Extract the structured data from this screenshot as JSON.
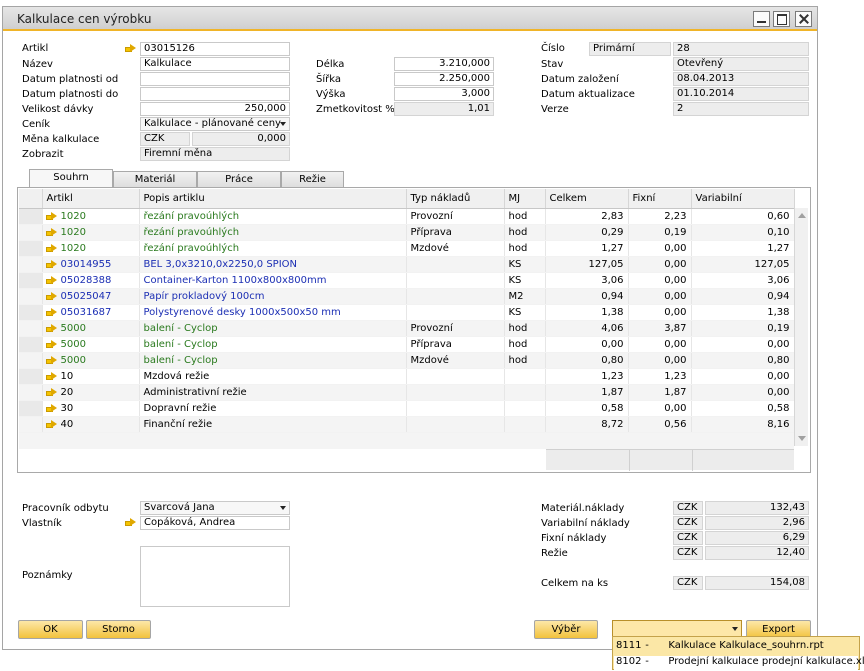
{
  "window": {
    "title": "Kalkulace cen výrobku"
  },
  "header_left": {
    "artikl": {
      "label": "Artikl",
      "value": "03015126"
    },
    "nazev": {
      "label": "Název",
      "value": "Kalkulace"
    },
    "platnost_od": {
      "label": "Datum platnosti od",
      "value": ""
    },
    "platnost_do": {
      "label": "Datum platnosti do",
      "value": ""
    },
    "velikost_davky": {
      "label": "Velikost dávky",
      "value": "250,000"
    },
    "cenik": {
      "label": "Ceník",
      "value": "Kalkulace - plánované ceny"
    },
    "mena": {
      "label": "Měna kalkulace",
      "currency": "CZK",
      "value": "0,000"
    },
    "zobrazit": {
      "label": "Zobrazit",
      "value": "Firemní měna"
    }
  },
  "header_mid": {
    "delka": {
      "label": "Délka",
      "value": "3.210,000"
    },
    "sirka": {
      "label": "Šířka",
      "value": "2.250,000"
    },
    "vyska": {
      "label": "Výška",
      "value": "3,000"
    },
    "zmetkovitost": {
      "label": "Zmetkovitost %",
      "value": "1,01"
    }
  },
  "header_right": {
    "cislo": {
      "label": "Číslo",
      "series": "Primární",
      "value": "28"
    },
    "stav": {
      "label": "Stav",
      "value": "Otevřený"
    },
    "zalozeni": {
      "label": "Datum založení",
      "value": "08.04.2013"
    },
    "aktualizace": {
      "label": "Datum aktualizace",
      "value": "01.10.2014"
    },
    "verze": {
      "label": "Verze",
      "value": "2"
    }
  },
  "tabs": [
    "Souhrn",
    "Materiál",
    "Práce",
    "Režie"
  ],
  "grid": {
    "columns": [
      "Artikl",
      "Popis artiklu",
      "Typ nákladů",
      "MJ",
      "Celkem",
      "Fixní",
      "Variabilní"
    ],
    "rows": [
      {
        "artikl": "1020",
        "popis": "řezání pravoúhlých",
        "typ": "Provozní",
        "mj": "hod",
        "celkem": "2,83",
        "fixni": "2,23",
        "variabilni": "0,60",
        "color": "green",
        "arrow": true
      },
      {
        "artikl": "1020",
        "popis": "řezání pravoúhlých",
        "typ": "Příprava",
        "mj": "hod",
        "celkem": "0,29",
        "fixni": "0,19",
        "variabilni": "0,10",
        "color": "green",
        "arrow": true
      },
      {
        "artikl": "1020",
        "popis": "řezání pravoúhlých",
        "typ": "Mzdové",
        "mj": "hod",
        "celkem": "1,27",
        "fixni": "0,00",
        "variabilni": "1,27",
        "color": "green",
        "arrow": true
      },
      {
        "artikl": "03014955",
        "popis": "BEL 3,0x3210,0x2250,0 SPION",
        "typ": "",
        "mj": "KS",
        "celkem": "127,05",
        "fixni": "0,00",
        "variabilni": "127,05",
        "color": "blue",
        "arrow": true
      },
      {
        "artikl": "05028388",
        "popis": "Container-Karton 1100x800x800mm",
        "typ": "",
        "mj": "KS",
        "celkem": "3,06",
        "fixni": "0,00",
        "variabilni": "3,06",
        "color": "blue",
        "arrow": true
      },
      {
        "artikl": "05025047",
        "popis": "Papír prokladový 100cm",
        "typ": "",
        "mj": "M2",
        "celkem": "0,94",
        "fixni": "0,00",
        "variabilni": "0,94",
        "color": "blue",
        "arrow": true
      },
      {
        "artikl": "05031687",
        "popis": "Polystyrenové desky 1000x500x50 mm",
        "typ": "",
        "mj": "KS",
        "celkem": "1,38",
        "fixni": "0,00",
        "variabilni": "1,38",
        "color": "blue",
        "arrow": true
      },
      {
        "artikl": "5000",
        "popis": "balení - Cyclop",
        "typ": "Provozní",
        "mj": "hod",
        "celkem": "4,06",
        "fixni": "3,87",
        "variabilni": "0,19",
        "color": "green",
        "arrow": true
      },
      {
        "artikl": "5000",
        "popis": "balení - Cyclop",
        "typ": "Příprava",
        "mj": "hod",
        "celkem": "0,00",
        "fixni": "0,00",
        "variabilni": "0,00",
        "color": "green",
        "arrow": true
      },
      {
        "artikl": "5000",
        "popis": "balení - Cyclop",
        "typ": "Mzdové",
        "mj": "hod",
        "celkem": "0,80",
        "fixni": "0,00",
        "variabilni": "0,80",
        "color": "green",
        "arrow": true
      },
      {
        "artikl": "10",
        "popis": "Mzdová režie",
        "typ": "",
        "mj": "",
        "celkem": "1,23",
        "fixni": "1,23",
        "variabilni": "0,00",
        "color": "black",
        "arrow": true
      },
      {
        "artikl": "20",
        "popis": "Administrativní režie",
        "typ": "",
        "mj": "",
        "celkem": "1,87",
        "fixni": "1,87",
        "variabilni": "0,00",
        "color": "black",
        "arrow": true
      },
      {
        "artikl": "30",
        "popis": "Dopravní režie",
        "typ": "",
        "mj": "",
        "celkem": "0,58",
        "fixni": "0,00",
        "variabilni": "0,58",
        "color": "black",
        "arrow": true
      },
      {
        "artikl": "40",
        "popis": "Finanční režie",
        "typ": "",
        "mj": "",
        "celkem": "8,72",
        "fixni": "0,56",
        "variabilni": "8,16",
        "color": "black",
        "arrow": true
      }
    ]
  },
  "footer_left": {
    "pracovnik": {
      "label": "Pracovník odbytu",
      "value": "Švarcová Jana"
    },
    "vlastnik": {
      "label": "Vlastník",
      "value": "Copáková, Andrea"
    },
    "poznamky": {
      "label": "Poznámky",
      "value": ""
    }
  },
  "totals": {
    "material": {
      "label": "Materiál.náklady",
      "currency": "CZK",
      "value": "132,43"
    },
    "variabilni": {
      "label": "Variabilní náklady",
      "currency": "CZK",
      "value": "2,96"
    },
    "fixni": {
      "label": "Fixní náklady",
      "currency": "CZK",
      "value": "6,29"
    },
    "rezie": {
      "label": "Režie",
      "currency": "CZK",
      "value": "12,40"
    },
    "celkem": {
      "label": "Celkem na ks",
      "currency": "CZK",
      "value": "154,08"
    }
  },
  "buttons": {
    "ok": "OK",
    "storno": "Storno",
    "vyber": "Výběr",
    "export": "Export"
  },
  "report_dropdown": {
    "value": "",
    "options": [
      {
        "code": "8111",
        "sep": "-",
        "name": "Kalkulace Kalkulace_souhrn.rpt"
      },
      {
        "code": "8102",
        "sep": "-",
        "name": "Prodejní kalkulace prodejní kalkulace.xltm"
      }
    ]
  },
  "colors": {
    "accent": "#f0b428",
    "link_green": "#2a7a1e",
    "link_blue": "#1c2fb4"
  }
}
